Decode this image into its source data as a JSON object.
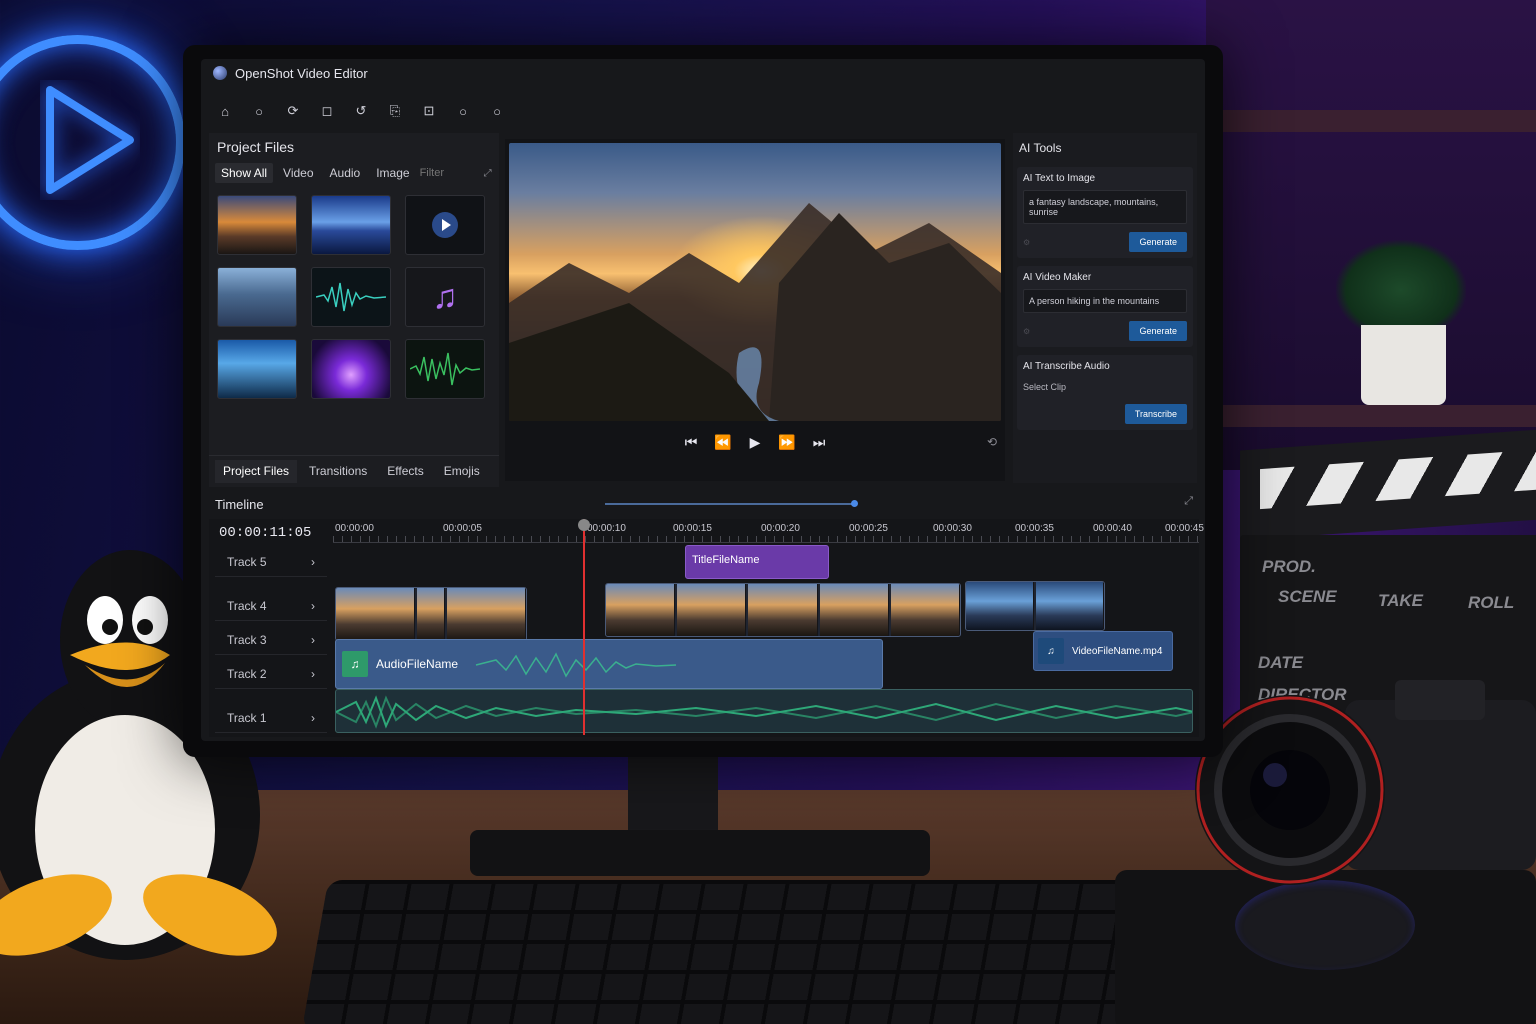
{
  "app": {
    "title": "OpenShot Video Editor"
  },
  "project_files": {
    "title": "Project Files",
    "filter_tabs": [
      "Show All",
      "Video",
      "Audio",
      "Image"
    ],
    "active_filter": "Show All",
    "filter_placeholder": "Filter",
    "bottom_tabs": [
      "Project Files",
      "Transitions",
      "Effects",
      "Emojis"
    ],
    "active_bottom_tab": "Project Files"
  },
  "ai_tools": {
    "title": "AI Tools",
    "text_to_image": {
      "title": "AI Text to Image",
      "prompt": "a fantasy landscape, mountains, sunrise",
      "button": "Generate"
    },
    "video_maker": {
      "title": "AI Video Maker",
      "prompt": "A person hiking in the mountains",
      "button": "Generate"
    },
    "transcribe": {
      "title": "AI Transcribe Audio",
      "select": "Select Clip",
      "button": "Transcribe"
    }
  },
  "timeline": {
    "title": "Timeline",
    "current_time": "00:00:11:05",
    "ticks": [
      "00:00:00",
      "00:00:05",
      "00:00:10",
      "00:00:15",
      "00:00:20",
      "00:00:25",
      "00:00:30",
      "00:00:35",
      "00:00:40",
      "00:00:45"
    ],
    "tracks": [
      "Track 5",
      "Track 4",
      "Track 3",
      "Track 2",
      "Track 1"
    ],
    "clips": {
      "title_clip": "TitleFileName",
      "audio_clip": "AudioFileName",
      "video_clip": "VideoFileName.mp4"
    }
  },
  "decor": {
    "clapper": [
      "PROD.",
      "SCENE",
      "TAKE",
      "ROLL",
      "DATE",
      "DIRECTOR"
    ]
  },
  "colors": {
    "accent": "#1e5a9a",
    "playhead": "#e03030",
    "title_clip": "#6a3aa8",
    "audio_clip": "#3a5a8a",
    "neon": "#3f8dff"
  }
}
